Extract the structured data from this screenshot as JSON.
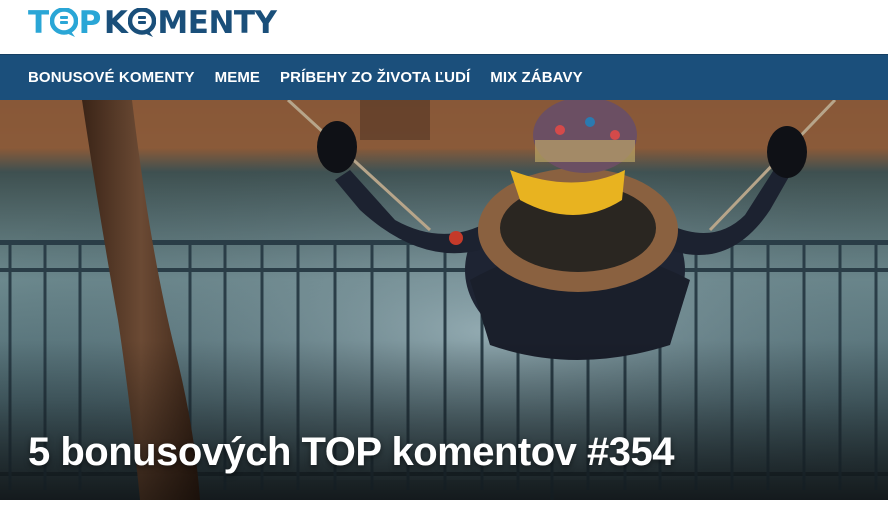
{
  "logo": {
    "part1": "T",
    "part1b": "P",
    "part2a": "K",
    "part2b": "MENTY"
  },
  "nav": {
    "items": [
      {
        "label": "BONUSOVÉ KOMENTY"
      },
      {
        "label": "MEME"
      },
      {
        "label": "PRÍBEHY ZO ŽIVOTA ĽUDÍ"
      },
      {
        "label": "MIX ZÁBAVY"
      }
    ]
  },
  "article": {
    "title": "5 bonusových TOP komentov #354"
  },
  "colors": {
    "nav_bg": "#1b4f7b",
    "logo_light": "#2aa6d6",
    "logo_dark": "#1a4f7a"
  }
}
